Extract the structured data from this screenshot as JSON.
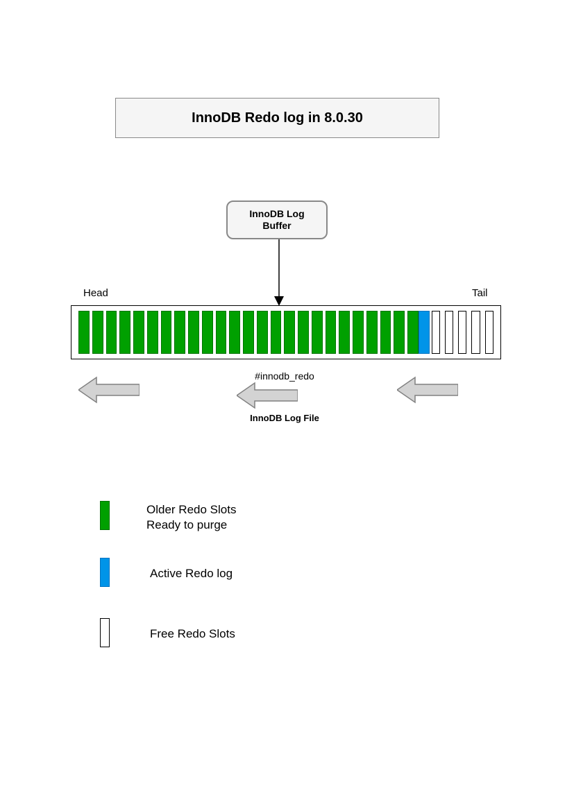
{
  "title": "InnoDB Redo log in 8.0.30",
  "buffer_label": "InnoDB Log Buffer",
  "head_label": "Head",
  "tail_label": "Tail",
  "redo_dir": "#innodb_redo",
  "logfile_label": "InnoDB Log File",
  "legend": {
    "green": "Older Redo Slots\nReady to purge",
    "blue": "Active Redo log",
    "free": "Free Redo Slots"
  },
  "slots": {
    "green_count": 25,
    "blue_count": 1,
    "free_count": 5
  }
}
